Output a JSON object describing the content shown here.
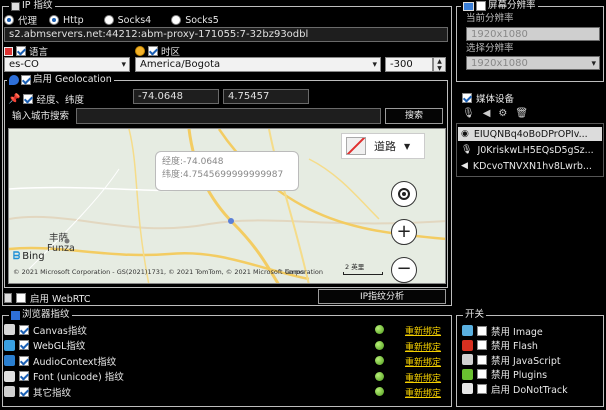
{
  "ip": {
    "group_title": "IP 指纹",
    "proxy_label": "代理",
    "http_label": "Http",
    "socks4_label": "Socks4",
    "socks5_label": "Socks5",
    "proxy_value": "s2.abmservers.net:44212:abm-proxy-171055:7-32bz93odbl"
  },
  "lang": {
    "label": "语言",
    "value": "es-CO"
  },
  "tz": {
    "label": "时区",
    "value": "America/Bogota",
    "offset": "-300"
  },
  "geo": {
    "group_title": "启用 Geolocation",
    "coord_label": "经度、纬度",
    "longitude": "-74.0648",
    "latitude": "4.75457",
    "city_label": "输入城市搜索",
    "city_value": "",
    "search_label": "搜索"
  },
  "map": {
    "type_label": "道路",
    "popup_lon": "经度:-74.0648",
    "popup_lat": "纬度:4.7545699999999987",
    "town_cn": "丰萨",
    "town_en": "Funza",
    "bing": "Bing",
    "copyright": "© 2021 Microsoft Corporation - GS(2021)1731, © 2021 TomTom, © 2021 Microsoft Corporation",
    "terms": "Terms",
    "scale": "2 英里"
  },
  "webrtc": {
    "label": "启用 WebRTC",
    "analyze_label": "IP指纹分析"
  },
  "browser_fp": {
    "group_title": "浏览器指纹",
    "reset_label": "重新绑定",
    "items": [
      {
        "label": "Canvas指纹",
        "icon": "canvas-icon",
        "color": "#d8d8d8"
      },
      {
        "label": "WebGL指纹",
        "icon": "webgl-icon",
        "color": "#3aa0e0"
      },
      {
        "label": "AudioContext指纹",
        "icon": "audio-icon",
        "color": "#2a7fd0"
      },
      {
        "label": "Font (unicode) 指纹",
        "icon": "font-icon",
        "color": "#e0e0e0"
      },
      {
        "label": "其它指纹",
        "icon": "other-icon",
        "color": "#d0d0d0"
      }
    ]
  },
  "screen": {
    "group_title": "屏幕分辨率",
    "current_label": "当前分辨率",
    "current_value": "1920x1080",
    "select_label": "选择分辨率",
    "select_value": "1920x1080"
  },
  "media": {
    "group_title": "媒体设备",
    "items": [
      {
        "label": "EIUQNBq4oBoDPrOPIv...",
        "icon": "camera-icon"
      },
      {
        "label": "J0KriskwLH5EQsD5gSz...",
        "icon": "microphone-icon"
      },
      {
        "label": "KDcvoTNVXN1hv8Lwrb...",
        "icon": "speaker-icon"
      }
    ]
  },
  "switches": {
    "group_title": "开关",
    "items": [
      {
        "label": "禁用 Image",
        "icon": "image-icon",
        "color": "#5ab0e0",
        "checked": false
      },
      {
        "label": "禁用 Flash",
        "icon": "flash-icon",
        "color": "#d83020",
        "checked": false
      },
      {
        "label": "禁用 JavaScript",
        "icon": "javascript-icon",
        "color": "#d0d0d0",
        "checked": false
      },
      {
        "label": "禁用 Plugins",
        "icon": "plugins-icon",
        "color": "#6ac030",
        "checked": false
      },
      {
        "label": "启用 DoNotTrack",
        "icon": "donottrack-icon",
        "color": "#e8e8e8",
        "checked": false
      }
    ]
  },
  "colors": {
    "accent": "#1a5fb4",
    "link": "#f5d000",
    "map_road": "#f4d47a"
  }
}
